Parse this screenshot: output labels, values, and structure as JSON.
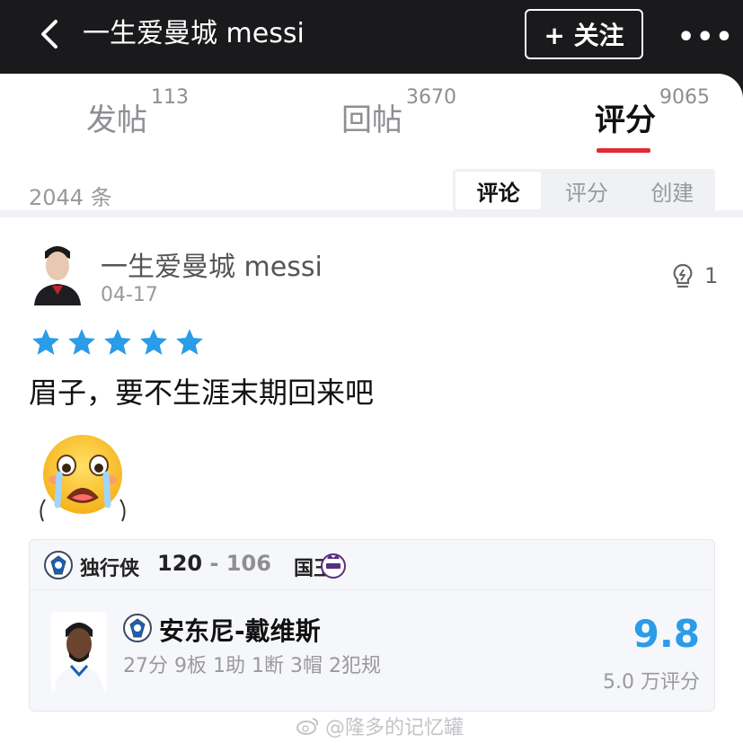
{
  "header": {
    "title": "一生爱曼城 messi",
    "follow_label": "+ 关注"
  },
  "tabs": [
    {
      "label": "发帖",
      "count": "113"
    },
    {
      "label": "回帖",
      "count": "3670"
    },
    {
      "label": "评分",
      "count": "9065",
      "active": true
    }
  ],
  "subbar": {
    "count": "2044 条",
    "segments": [
      "评论",
      "评分",
      "创建"
    ],
    "active_segment": "评论"
  },
  "post": {
    "username": "一生爱曼城 messi",
    "date": "04-17",
    "likes": "1",
    "stars": 5,
    "text": "眉子，要不生涯末期回来吧",
    "emoji": "crying-face-emoji"
  },
  "game_card": {
    "team_home": "独行侠",
    "score_home": "120",
    "score_sep": "-",
    "score_away": "106",
    "team_away": "国王",
    "player_name": "安东尼-戴维斯",
    "player_stats": "27分 9板 1助 1断 3帽 2犯规",
    "rating": "9.8",
    "rating_count": "5.0 万评分"
  },
  "watermark": "@隆多的记忆罐",
  "colors": {
    "accent": "#e12a35",
    "rating": "#2a9ce8",
    "star": "#2a9ce8"
  }
}
